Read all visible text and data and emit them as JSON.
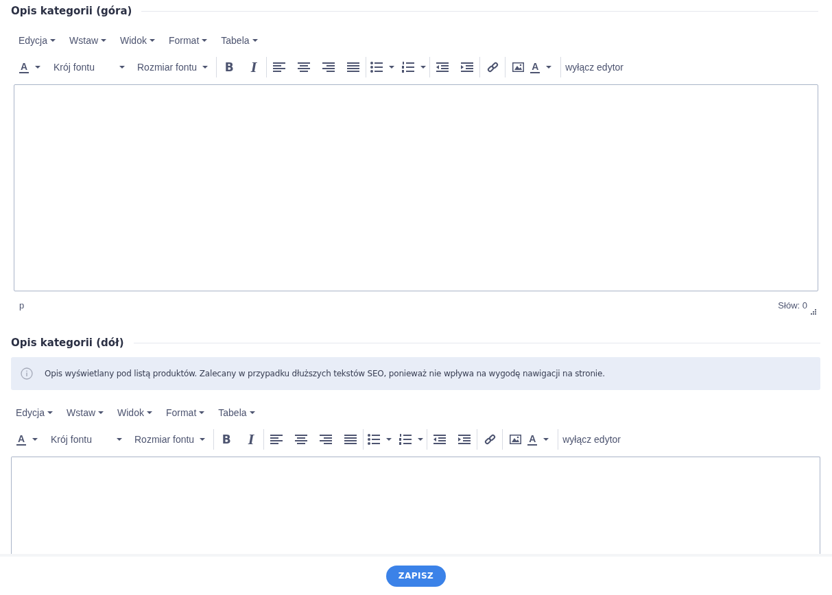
{
  "sections": [
    {
      "title": "Opis kategorii (góra)",
      "menu": [
        "Edycja",
        "Wstaw",
        "Widok",
        "Format",
        "Tabela"
      ],
      "toolbar": {
        "text_color": "A",
        "font_family": "Krój fontu",
        "font_size": "Rozmiar fontu",
        "bold": "B",
        "italic": "I",
        "background_color": "A",
        "toggle_editor": "wyłącz edytor"
      },
      "statusbar": {
        "path": "p",
        "word_count": "Słów: 0"
      }
    },
    {
      "title": "Opis kategorii (dół)",
      "info": "Opis wyświetlany pod listą produktów. Zalecany w przypadku dłuższych tekstów SEO, ponieważ nie wpływa na wygodę nawigacji na stronie.",
      "menu": [
        "Edycja",
        "Wstaw",
        "Widok",
        "Format",
        "Tabela"
      ],
      "toolbar": {
        "text_color": "A",
        "font_family": "Krój fontu",
        "font_size": "Rozmiar fontu",
        "bold": "B",
        "italic": "I",
        "background_color": "A",
        "toggle_editor": "wyłącz edytor"
      }
    }
  ],
  "save_button": "ZAPISZ"
}
